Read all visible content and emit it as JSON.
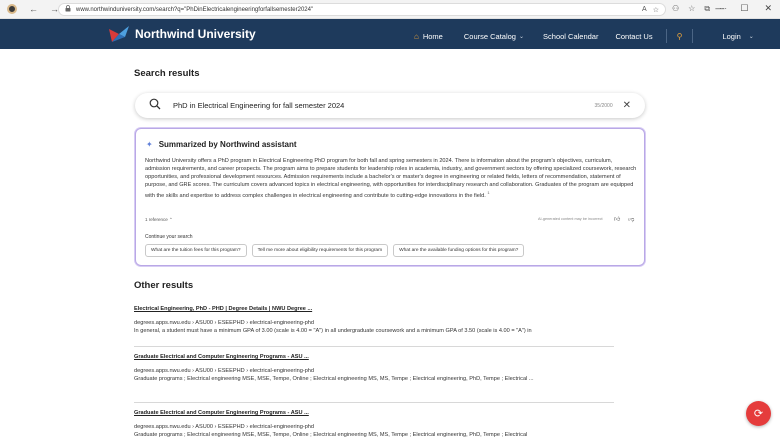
{
  "browser": {
    "back_icon": "←",
    "forward_icon": "→",
    "reload_icon": "↻",
    "url": "www.northwinduniversity.com/search?q=\"PhDinElectricalengineeringforfallsemester2024\"",
    "window_controls": [
      "—",
      "☐",
      "✕"
    ]
  },
  "site": {
    "title": "Northwind University",
    "brand_color": "#1e3a5c",
    "accent_color": "#e8a33c",
    "nav": {
      "home": "Home",
      "course_catalog": "Course Catalog",
      "school_calendar": "School Calendar",
      "contact_us": "Contact Us",
      "login": "Login"
    }
  },
  "search": {
    "heading": "Search results",
    "query": "PhD in Electrical Engineering for fall semester 2024",
    "char_count": "35/2000"
  },
  "assistant": {
    "title": "Summarized by Northwind assistant",
    "summary": "Northwind University offers a PhD program in Electrical Engineering PhD program for both fall and spring semesters in 2024. There is information about the program's objectives, curriculum, admission requirements, and career prospects. The program aims to prepare students for leadership roles in academia, industry, and government sectors by offering specialized coursework, research opportunities, and professional development resources. Admission requirements include a bachelor's or master's degree in engineering or related fields, letters of recommendation, statement of purpose, and GRE scores. The curriculum covers advanced topics in electrical engineering, with opportunities for interdisciplinary research and collaboration. Graduates of the program are equipped with the skills and expertise to address complex challenges in electrical engineering and contribute to cutting-edge innovations in the field.",
    "citation": "1",
    "references": "1 reference",
    "disclaimer": "AI-generated content may be incorrect",
    "continue_label": "Continue your search",
    "suggestions": [
      "What are the tuition fees for this program?",
      "Tell me more about eligibility requirements for this program",
      "What are the available funding options for this program?"
    ]
  },
  "other_results": {
    "heading": "Other results",
    "items": [
      {
        "title": "Electrical Engineering, PhD - PHD | Degree Details | NWU Degree ...",
        "crumb": "degrees.apps.nwu.edu › ASU00 › ESEEPHD › electrical-engineering-phd",
        "snippet": "In general, a student must have a minimum GPA of 3.00 (scale is 4.00 = \"A\") in all undergraduate coursework and a minimum GPA of 3.50 (scale is 4.00 = \"A\") in"
      },
      {
        "title": "Graduate Electrical and Computer Engineering Programs - ASU ...",
        "crumb": "degrees.apps.nwu.edu › ASU00 › ESEEPHD › electrical-engineering-phd",
        "snippet": "Graduate programs ; Electrical engineering MSE, MSE, Tempe, Online ; Electrical engineering MS, MS, Tempe ; Electrical engineering, PhD, Tempe ; Electrical ..."
      },
      {
        "title": "Graduate Electrical and Computer Engineering Programs - ASU ...",
        "crumb": "degrees.apps.nwu.edu › ASU00 › ESEEPHD › electrical-engineering-phd",
        "snippet": "Graduate programs ; Electrical engineering MSE, MSE, Tempe, Online ; Electrical engineering MS, MS, Tempe ; Electrical engineering, PhD, Tempe ; Electrical"
      }
    ]
  }
}
